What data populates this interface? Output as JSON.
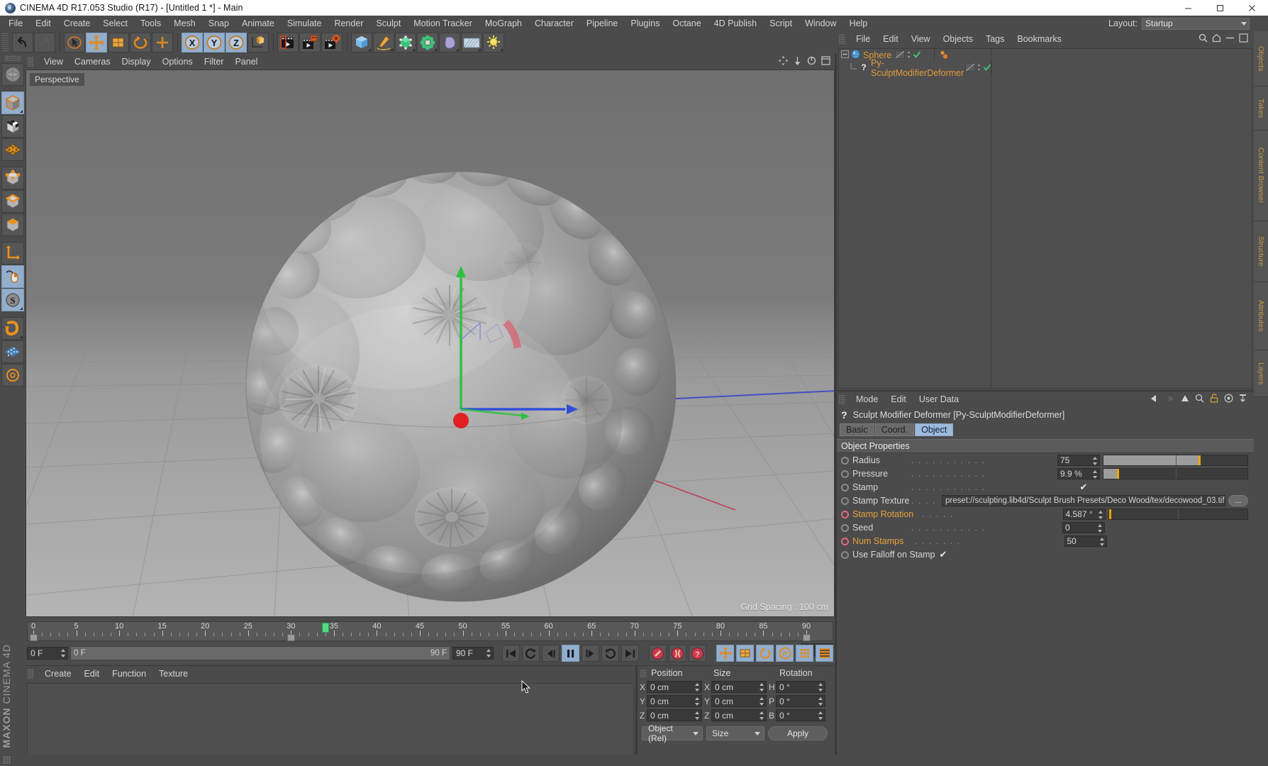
{
  "window": {
    "title": "CINEMA 4D R17.053 Studio (R17) - [Untitled 1 *] - Main",
    "icon": "cinema4d-logo-icon",
    "minimize": "minimize-icon",
    "maximize": "maximize-icon",
    "close": "close-icon"
  },
  "menubar": {
    "items": [
      "File",
      "Edit",
      "Create",
      "Select",
      "Tools",
      "Mesh",
      "Snap",
      "Animate",
      "Simulate",
      "Render",
      "Sculpt",
      "Motion Tracker",
      "MoGraph",
      "Character",
      "Pipeline",
      "Plugins",
      "Octane",
      "4D Publish",
      "Script",
      "Window",
      "Help"
    ],
    "layout_label": "Layout:",
    "layout_value": "Startup"
  },
  "toolbar": {
    "groups": [
      {
        "buttons": [
          {
            "name": "undo-icon",
            "label": "undo",
            "active": false
          },
          {
            "name": "redo-icon",
            "label": "redo",
            "active": false
          }
        ]
      },
      {
        "buttons": [
          {
            "name": "live-selection-icon",
            "label": "Live Selection",
            "active": false
          },
          {
            "name": "move-icon",
            "label": "Move",
            "active": true
          },
          {
            "name": "scale-icon",
            "label": "Scale",
            "active": false
          },
          {
            "name": "rotate-icon",
            "label": "Rotate",
            "active": false
          },
          {
            "name": "world-axis-icon",
            "label": "World/Object Axis",
            "active": false
          }
        ]
      },
      {
        "buttons": [
          {
            "name": "axis-x-icon",
            "label": "X",
            "active": true
          },
          {
            "name": "axis-y-icon",
            "label": "Y",
            "active": true
          },
          {
            "name": "axis-z-icon",
            "label": "Z",
            "active": true
          },
          {
            "name": "object-world-coord-icon",
            "label": "World/Object coordinate system",
            "active": false
          }
        ]
      },
      {
        "buttons": [
          {
            "name": "render-view-icon",
            "label": "Render View",
            "active": false
          },
          {
            "name": "render-region-icon",
            "label": "Render to Picture Viewer",
            "active": false
          },
          {
            "name": "render-settings-icon",
            "label": "Edit Render Settings",
            "active": false
          }
        ]
      },
      {
        "buttons": [
          {
            "name": "cube-primitive-icon",
            "label": "Add Cube Object",
            "active": false
          },
          {
            "name": "spline-pen-icon",
            "label": "Add Spline",
            "active": false
          },
          {
            "name": "generator-icon",
            "label": "Add Generator",
            "active": false
          },
          {
            "name": "deformer-icon",
            "label": "Add Deformer",
            "active": false
          },
          {
            "name": "environment-icon",
            "label": "Add Scene Object",
            "active": false
          },
          {
            "name": "camera-icon",
            "label": "Add Camera",
            "active": false
          },
          {
            "name": "light-icon",
            "label": "Add Light",
            "active": false
          }
        ]
      }
    ]
  },
  "left_toolbar": {
    "buttons": [
      {
        "name": "texture-axis-icon",
        "label": "Texture Tool",
        "active": false
      },
      {
        "name": "model-mode-icon",
        "label": "Model Mode",
        "active": true
      },
      {
        "name": "object-mode-icon",
        "label": "Object Mode",
        "active": false
      },
      {
        "name": "points-mode-icon",
        "label": "Polygon Mode",
        "active": false
      },
      {
        "name": "vertex-mode-icon",
        "label": "Point Mode",
        "active": false
      },
      {
        "name": "edge-mode-icon",
        "label": "Edge Mode",
        "active": false
      },
      {
        "name": "polygon-mode-icon",
        "label": "Polygon Mode",
        "active": false
      },
      {
        "name": "axis-modify-icon",
        "label": "Enable Axis Modification",
        "active": false
      },
      {
        "name": "viewport-solo-icon",
        "label": "Viewport Solo",
        "active": true
      },
      {
        "name": "snap-enable-icon",
        "label": "Enable Snapping",
        "active": true
      },
      {
        "name": "workplane-icon",
        "label": "Workplane",
        "active": false
      },
      {
        "name": "lock-workplane-icon",
        "label": "Lock Workplane",
        "active": false
      },
      {
        "name": "measure-icon",
        "label": "Measure",
        "active": false
      }
    ]
  },
  "viewport": {
    "menu": [
      "View",
      "Cameras",
      "Display",
      "Options",
      "Filter",
      "Panel"
    ],
    "view_label": "Perspective",
    "grid_spacing": "Grid Spacing : 100 cm",
    "nav_icons": [
      "move-view-icon",
      "scale-view-icon",
      "rotate-view-icon",
      "maximize-view-icon"
    ]
  },
  "object_manager": {
    "menu": [
      "File",
      "Edit",
      "View",
      "Objects",
      "Tags",
      "Bookmarks"
    ],
    "objects": [
      {
        "name": "Sphere",
        "icon": "sphere-object-icon",
        "depth": 0,
        "expanded": true,
        "visible_editor": "on",
        "visible_render": "on",
        "has_tag": true
      },
      {
        "name": "Py-SculptModifierDeformer",
        "icon": "python-plugin-icon",
        "depth": 1,
        "expanded": false,
        "visible_editor": "on",
        "visible_render": "on",
        "has_tag": false
      }
    ],
    "header_icons": [
      "filter-icon",
      "search-icon"
    ]
  },
  "attribute_manager": {
    "menu": [
      "Mode",
      "Edit",
      "User Data"
    ],
    "icons": [
      "back-arrow-icon",
      "forward-arrow-icon",
      "up-arrow-icon",
      "search-icon",
      "lock-icon",
      "target-icon",
      "pin-icon"
    ],
    "object_title": "Sculpt Modifier Deformer [Py-SculptModifierDeformer]",
    "object_icon": "python-plugin-icon",
    "tabs": [
      {
        "label": "Basic",
        "active": false
      },
      {
        "label": "Coord.",
        "active": false
      },
      {
        "label": "Object",
        "active": true
      }
    ],
    "section_title": "Object Properties",
    "properties": [
      {
        "label": "Radius",
        "type": "slider",
        "value": "75",
        "fill_pct": 66,
        "handle_pct": 66,
        "animated": false
      },
      {
        "label": "Pressure",
        "type": "slider",
        "value": "9.9 %",
        "fill_pct": 9.2,
        "handle_pct": 9.2,
        "animated": false
      },
      {
        "label": "Stamp",
        "type": "checkbox",
        "value": "✔",
        "animated": false
      },
      {
        "label": "Stamp Texture",
        "type": "text",
        "value": "preset://sculpting.lib4d/Sculpt Brush Presets/Deco Wood/tex/decowood_03.tif",
        "button": "...",
        "animated": false
      },
      {
        "label": "Stamp Rotation",
        "type": "slider",
        "value": "4.587 °",
        "fill_pct": 0,
        "handle_pct": 0.5,
        "animated": true
      },
      {
        "label": "Seed",
        "type": "number",
        "value": "0",
        "animated": false
      },
      {
        "label": "Num Stamps",
        "type": "number",
        "value": "50",
        "animated": true
      },
      {
        "label": "Use Falloff on Stamp",
        "type": "checkbox",
        "value": "✔",
        "animated": false
      }
    ]
  },
  "timeline": {
    "start_frame": "0 F",
    "end_frame": "90 F",
    "preview_min": "0 F",
    "preview_max": "90 F",
    "current_frame": "34 F",
    "ticks": [
      0,
      5,
      10,
      15,
      20,
      25,
      30,
      35,
      40,
      45,
      50,
      55,
      60,
      65,
      70,
      75,
      80,
      85,
      90
    ],
    "playhead_frame": 34,
    "key_markers": [
      0,
      30,
      90
    ],
    "transport": [
      {
        "name": "goto-start-icon",
        "label": "Go to Start",
        "active": false
      },
      {
        "name": "play-backward-icon",
        "label": "Play Backwards",
        "active": false
      },
      {
        "name": "step-back-icon",
        "label": "Go to Previous Frame",
        "active": false
      },
      {
        "name": "pause-icon",
        "label": "Play/Pause",
        "active": true
      },
      {
        "name": "step-forward-icon",
        "label": "Go to Next Frame",
        "active": false
      },
      {
        "name": "play-forward-icon",
        "label": "Play Forwards",
        "active": false
      },
      {
        "name": "goto-end-icon",
        "label": "Go to End",
        "active": false
      }
    ],
    "record_buttons": [
      {
        "name": "record-icon",
        "label": "Record Active Objects",
        "active": false
      },
      {
        "name": "autokey-icon",
        "label": "Autokeying",
        "active": false
      },
      {
        "name": "keyframe-selection-icon",
        "label": "Keyframe Selection",
        "active": false
      }
    ],
    "param_buttons": [
      {
        "name": "position-key-icon",
        "label": "Position",
        "active": true
      },
      {
        "name": "scale-key-icon",
        "label": "Scale",
        "active": true
      },
      {
        "name": "rotation-key-icon",
        "label": "Rotation",
        "active": true
      },
      {
        "name": "parameter-key-icon",
        "label": "Parameter",
        "active": true
      },
      {
        "name": "pla-key-icon",
        "label": "Point Level Animation",
        "active": true
      },
      {
        "name": "timeline-mode-icon",
        "label": "Timeline Mode",
        "active": true
      }
    ]
  },
  "material_manager": {
    "menu": [
      "Create",
      "Edit",
      "Function",
      "Texture"
    ]
  },
  "coordinates": {
    "headers": [
      "Position",
      "Size",
      "Rotation"
    ],
    "rows": [
      {
        "pos_label": "X",
        "pos_value": "0 cm",
        "size_label": "X",
        "size_value": "0 cm",
        "rot_label": "H",
        "rot_value": "0 °"
      },
      {
        "pos_label": "Y",
        "pos_value": "0 cm",
        "size_label": "Y",
        "size_value": "0 cm",
        "rot_label": "P",
        "rot_value": "0 °"
      },
      {
        "pos_label": "Z",
        "pos_value": "0 cm",
        "size_label": "Z",
        "size_value": "0 cm",
        "rot_label": "B",
        "rot_value": "0 °"
      }
    ],
    "mode_dropdown": "Object (Rel)",
    "size_dropdown": "Size",
    "apply_button": "Apply"
  },
  "rail_tabs": [
    "Objects",
    "Takes",
    "Content Browser",
    "Structure",
    "Attributes",
    "Layers"
  ],
  "branding": {
    "line1": "MAXON",
    "line2": "CINEMA 4D"
  },
  "colors": {
    "accent_orange": "#e09a3a",
    "highlight_blue": "#93aecd",
    "panel_bg": "#4b4b4b",
    "field_bg": "#393939",
    "slider_handle": "#f0a500",
    "anim_red": "#e06b7e"
  }
}
